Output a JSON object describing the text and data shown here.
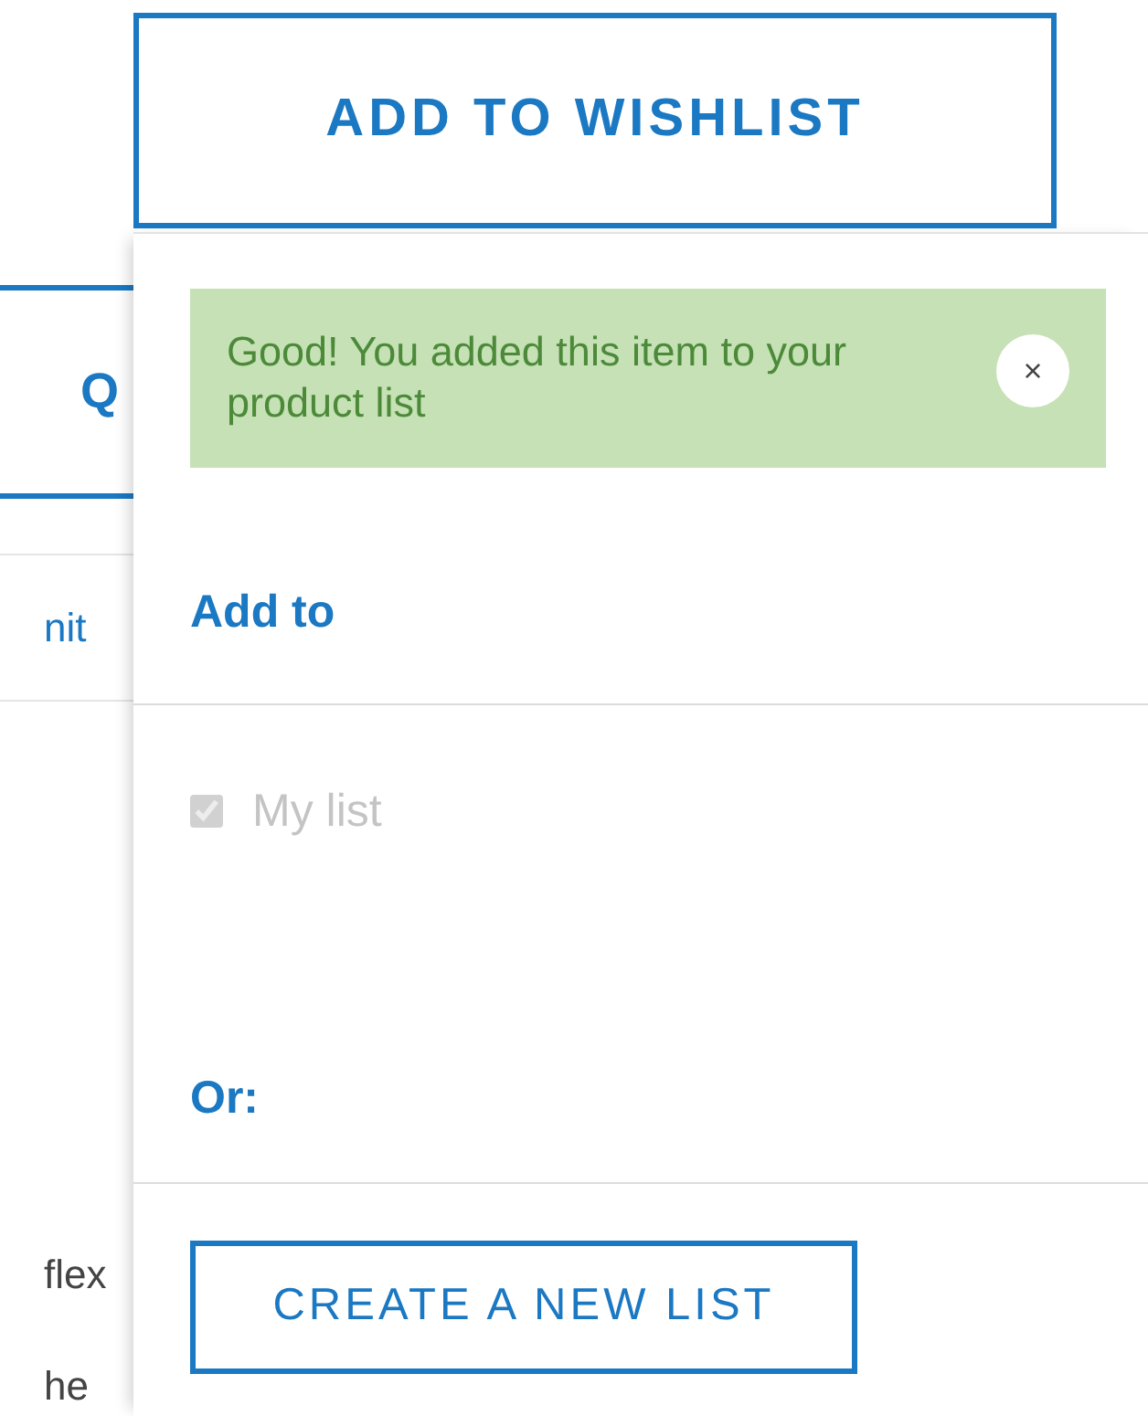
{
  "background": {
    "tab": "Q",
    "link": "nit",
    "texts": [
      "flex",
      "he"
    ]
  },
  "wishlist_button": "ADD TO WISHLIST",
  "popup": {
    "alert": {
      "message": "Good! You added this item to your product list",
      "close": "×"
    },
    "add_to_heading": "Add to",
    "lists": [
      {
        "label": "My list",
        "checked": true,
        "disabled": true
      }
    ],
    "or_heading": "Or:",
    "create_button": "CREATE A NEW LIST"
  }
}
